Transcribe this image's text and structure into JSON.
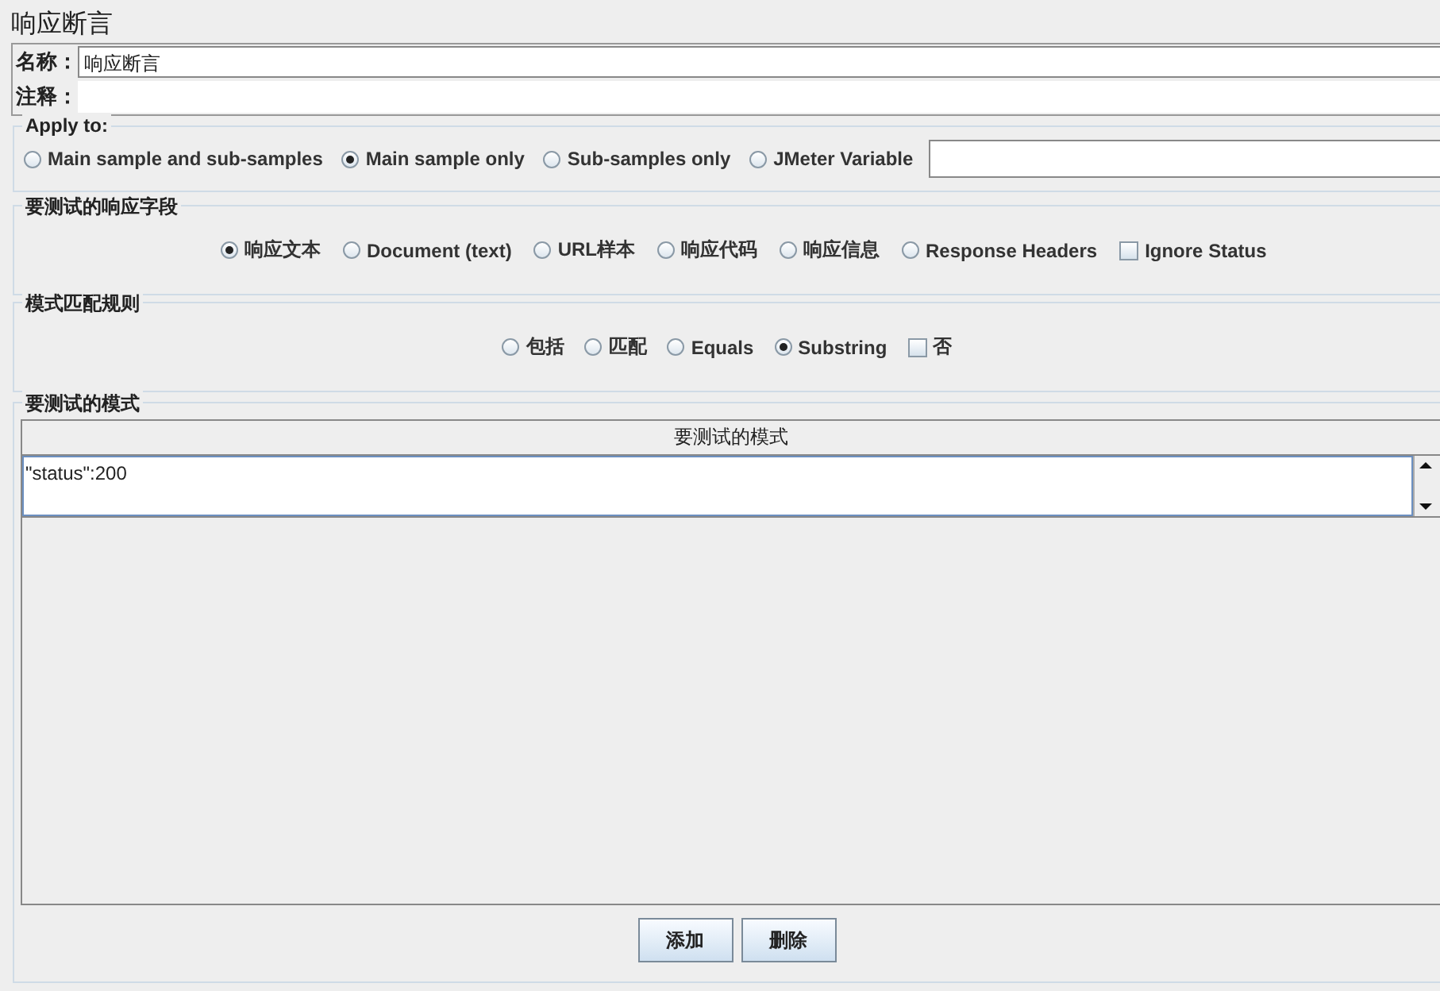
{
  "title": "响应断言",
  "name_field": {
    "label": "名称：",
    "value": "响应断言"
  },
  "comment_field": {
    "label": "注释："
  },
  "apply_to": {
    "legend": "Apply to:",
    "options": [
      {
        "kind": "radio",
        "label": "Main sample and sub-samples",
        "selected": false
      },
      {
        "kind": "radio",
        "label": "Main sample only",
        "selected": true
      },
      {
        "kind": "radio",
        "label": "Sub-samples only",
        "selected": false
      },
      {
        "kind": "radio",
        "label": "JMeter Variable",
        "selected": false
      }
    ]
  },
  "response_field": {
    "legend": "要测试的响应字段",
    "options": [
      {
        "kind": "radio",
        "label": "响应文本",
        "selected": true
      },
      {
        "kind": "radio",
        "label": "Document (text)",
        "selected": false
      },
      {
        "kind": "radio",
        "label": "URL样本",
        "selected": false
      },
      {
        "kind": "radio",
        "label": "响应代码",
        "selected": false
      },
      {
        "kind": "radio",
        "label": "响应信息",
        "selected": false
      },
      {
        "kind": "radio",
        "label": "Response Headers",
        "selected": false
      },
      {
        "kind": "checkbox",
        "label": "Ignore Status",
        "checked": false
      }
    ]
  },
  "pattern_rules": {
    "legend": "模式匹配规则",
    "options": [
      {
        "kind": "radio",
        "label": "包括",
        "selected": false
      },
      {
        "kind": "radio",
        "label": "匹配",
        "selected": false
      },
      {
        "kind": "radio",
        "label": "Equals",
        "selected": false
      },
      {
        "kind": "radio",
        "label": "Substring",
        "selected": true
      },
      {
        "kind": "checkbox",
        "label": "否",
        "checked": false
      }
    ]
  },
  "patterns": {
    "legend": "要测试的模式",
    "column": "要测试的模式",
    "rows": [
      "\"status\":200"
    ]
  },
  "buttons": [
    "添加",
    "删除"
  ]
}
